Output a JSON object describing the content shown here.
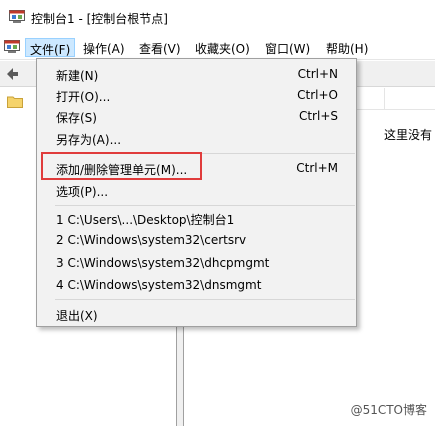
{
  "window": {
    "title": "控制台1 - [控制台根节点]"
  },
  "menubar": {
    "items": [
      {
        "label": "文件(F)",
        "active": true
      },
      {
        "label": "操作(A)"
      },
      {
        "label": "查看(V)"
      },
      {
        "label": "收藏夹(O)"
      },
      {
        "label": "窗口(W)"
      },
      {
        "label": "帮助(H)"
      }
    ]
  },
  "right_pane": {
    "empty_text": "这里没有"
  },
  "file_menu": {
    "items": [
      {
        "label": "新建(N)",
        "shortcut": "Ctrl+N"
      },
      {
        "label": "打开(O)...",
        "shortcut": "Ctrl+O"
      },
      {
        "label": "保存(S)",
        "shortcut": "Ctrl+S"
      },
      {
        "label": "另存为(A)...",
        "shortcut": ""
      },
      {
        "label": "添加/删除管理单元(M)...",
        "shortcut": "Ctrl+M",
        "highlighted": true
      },
      {
        "label": "选项(P)...",
        "shortcut": ""
      },
      {
        "label": "1 C:\\Users\\...\\Desktop\\控制台1",
        "shortcut": ""
      },
      {
        "label": "2 C:\\Windows\\system32\\certsrv",
        "shortcut": ""
      },
      {
        "label": "3 C:\\Windows\\system32\\dhcpmgmt",
        "shortcut": ""
      },
      {
        "label": "4 C:\\Windows\\system32\\dnsmgmt",
        "shortcut": ""
      },
      {
        "label": "退出(X)",
        "shortcut": ""
      }
    ],
    "highlight_color": "#e03c3c"
  },
  "watermark": "@51CTO博客",
  "icons": {
    "app": "mmc-console-icon",
    "back": "back-arrow-icon",
    "folder": "folder-icon"
  }
}
